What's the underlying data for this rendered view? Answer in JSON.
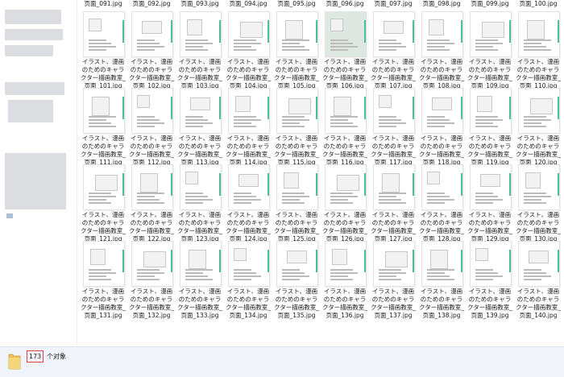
{
  "files": {
    "top_partial": [
      "页面_091.jpg",
      "页面_092.jpg",
      "页面_093.jpg",
      "页面_094.jpg",
      "页面_095.jpg",
      "页面_096.jpg",
      "页面_097.jpg",
      "页面_098.jpg",
      "页面_099.jpg",
      "页面_100.jpg"
    ],
    "caption_line1": "イラスト、漫画",
    "caption_line2": "のためのキャラ",
    "caption_line3": "クター描画教室_",
    "rows": [
      [
        "页面_101.jpg",
        "页面_102.jpg",
        "页面_103.jpg",
        "页面_104.jpg",
        "页面_105.jpg",
        "页面_106.jpg",
        "页面_107.jpg",
        "页面_108.jpg",
        "页面_109.jpg",
        "页面_110.jpg"
      ],
      [
        "页面_111.jpg",
        "页面_112.jpg",
        "页面_113.jpg",
        "页面_114.jpg",
        "页面_115.jpg",
        "页面_116.jpg",
        "页面_117.jpg",
        "页面_118.jpg",
        "页面_119.jpg",
        "页面_120.jpg"
      ],
      [
        "页面_121.jpg",
        "页面_122.jpg",
        "页面_123.jpg",
        "页面_124.jpg",
        "页面_125.jpg",
        "页面_126.jpg",
        "页面_127.jpg",
        "页面_128.jpg",
        "页面_129.jpg",
        "页面_130.jpg"
      ],
      [
        "页面_131.jpg",
        "页面_132.jpg",
        "页面_133.jpg",
        "页面_134.jpg",
        "页面_135.jpg",
        "页面_136.jpg",
        "页面_137.jpg",
        "页面_138.jpg",
        "页面_139.jpg",
        "页面_140.jpg"
      ]
    ]
  },
  "status": {
    "count": "173",
    "label": "个对象"
  }
}
